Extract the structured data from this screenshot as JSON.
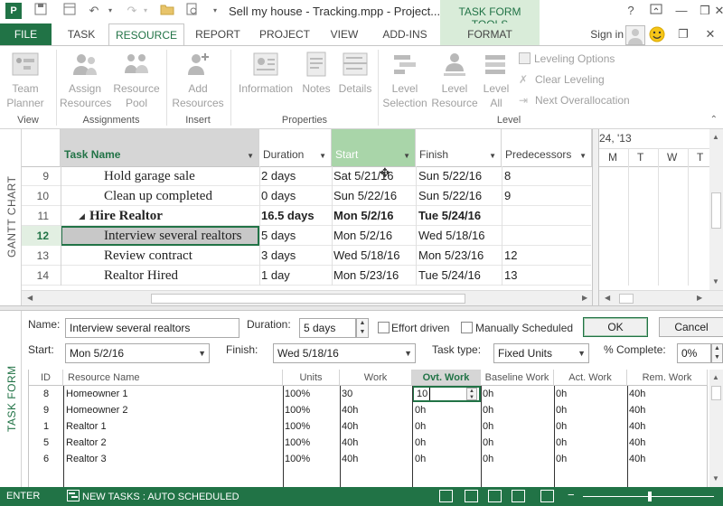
{
  "app": {
    "title": "Sell my house - Tracking.mpp - Project...",
    "context_tools": "TASK FORM TOOLS",
    "help": "?",
    "min": "—",
    "max": "❒",
    "close": "✕",
    "accent": "#217346"
  },
  "tabs": {
    "file": "FILE",
    "task": "TASK",
    "resource": "RESOURCE",
    "report": "REPORT",
    "project": "PROJECT",
    "view": "VIEW",
    "addins": "ADD-INS",
    "format": "FORMAT",
    "sign_in": "Sign in"
  },
  "ribbon": {
    "team_planner_1": "Team",
    "team_planner_2": "Planner",
    "assign_1": "Assign",
    "assign_2": "Resources",
    "pool_1": "Resource",
    "pool_2": "Pool",
    "add_1": "Add",
    "add_2": "Resources",
    "information": "Information",
    "notes": "Notes",
    "details": "Details",
    "level_sel_1": "Level",
    "level_sel_2": "Selection",
    "level_res_1": "Level",
    "level_res_2": "Resource",
    "level_all_1": "Level",
    "level_all_2": "All",
    "leveling_options": "Leveling Options",
    "clear_leveling": "Clear Leveling",
    "next_overallocation": "Next Overallocation",
    "grp_view": "View",
    "grp_assignments": "Assignments",
    "grp_insert": "Insert",
    "grp_properties": "Properties",
    "grp_level": "Level"
  },
  "sheet": {
    "side_label": "GANTT CHART",
    "headers": {
      "task_name": "Task Name",
      "duration": "Duration",
      "start": "Start",
      "finish": "Finish",
      "predecessors": "Predecessors"
    },
    "timescale": {
      "week": "24, '13",
      "days": [
        "M",
        "T",
        "W",
        "T"
      ]
    },
    "rows": [
      {
        "id": "9",
        "name": "Hold garage sale",
        "duration": "2 days",
        "start": "Sat 5/21/16",
        "finish": "Sun 5/22/16",
        "pred": "8"
      },
      {
        "id": "10",
        "name": "Clean up completed",
        "duration": "0 days",
        "start": "Sun 5/22/16",
        "finish": "Sun 5/22/16",
        "pred": "9"
      },
      {
        "id": "11",
        "name": "Hire Realtor",
        "duration": "16.5 days",
        "start": "Mon 5/2/16",
        "finish": "Tue 5/24/16",
        "pred": ""
      },
      {
        "id": "12",
        "name": "Interview several realtors",
        "duration": "5 days",
        "start": "Mon 5/2/16",
        "finish": "Wed 5/18/16",
        "pred": ""
      },
      {
        "id": "13",
        "name": "Review contract",
        "duration": "3 days",
        "start": "Wed 5/18/16",
        "finish": "Mon 5/23/16",
        "pred": "12"
      },
      {
        "id": "14",
        "name": "Realtor Hired",
        "duration": "1 day",
        "start": "Mon 5/23/16",
        "finish": "Tue 5/24/16",
        "pred": "13"
      }
    ]
  },
  "form": {
    "side_label": "TASK FORM",
    "name_label": "Name:",
    "name_value": "Interview several realtors",
    "duration_label": "Duration:",
    "duration_value": "5 days",
    "effort_driven": "Effort driven",
    "manually_scheduled": "Manually Scheduled",
    "ok": "OK",
    "cancel": "Cancel",
    "start_label": "Start:",
    "start_value": "Mon 5/2/16",
    "finish_label": "Finish:",
    "finish_value": "Wed 5/18/16",
    "task_type_label": "Task type:",
    "task_type_value": "Fixed Units",
    "pct_label": "% Complete:",
    "pct_value": "0%",
    "headers": {
      "id": "ID",
      "resource_name": "Resource Name",
      "units": "Units",
      "work": "Work",
      "ovt_work": "Ovt. Work",
      "baseline_work": "Baseline Work",
      "act_work": "Act. Work",
      "rem_work": "Rem. Work"
    },
    "rows": [
      {
        "id": "8",
        "name": "Homeowner 1",
        "units": "100%",
        "work": "30",
        "ovt": "10",
        "baseline": "0h",
        "act": "0h",
        "rem": "40h"
      },
      {
        "id": "9",
        "name": "Homeowner 2",
        "units": "100%",
        "work": "40h",
        "ovt": "0h",
        "baseline": "0h",
        "act": "0h",
        "rem": "40h"
      },
      {
        "id": "1",
        "name": "Realtor 1",
        "units": "100%",
        "work": "40h",
        "ovt": "0h",
        "baseline": "0h",
        "act": "0h",
        "rem": "40h"
      },
      {
        "id": "5",
        "name": "Realtor 2",
        "units": "100%",
        "work": "40h",
        "ovt": "0h",
        "baseline": "0h",
        "act": "0h",
        "rem": "40h"
      },
      {
        "id": "6",
        "name": "Realtor 3",
        "units": "100%",
        "work": "40h",
        "ovt": "0h",
        "baseline": "0h",
        "act": "0h",
        "rem": "40h"
      }
    ]
  },
  "status": {
    "mode": "ENTER",
    "new_tasks": "NEW TASKS : AUTO SCHEDULED"
  }
}
